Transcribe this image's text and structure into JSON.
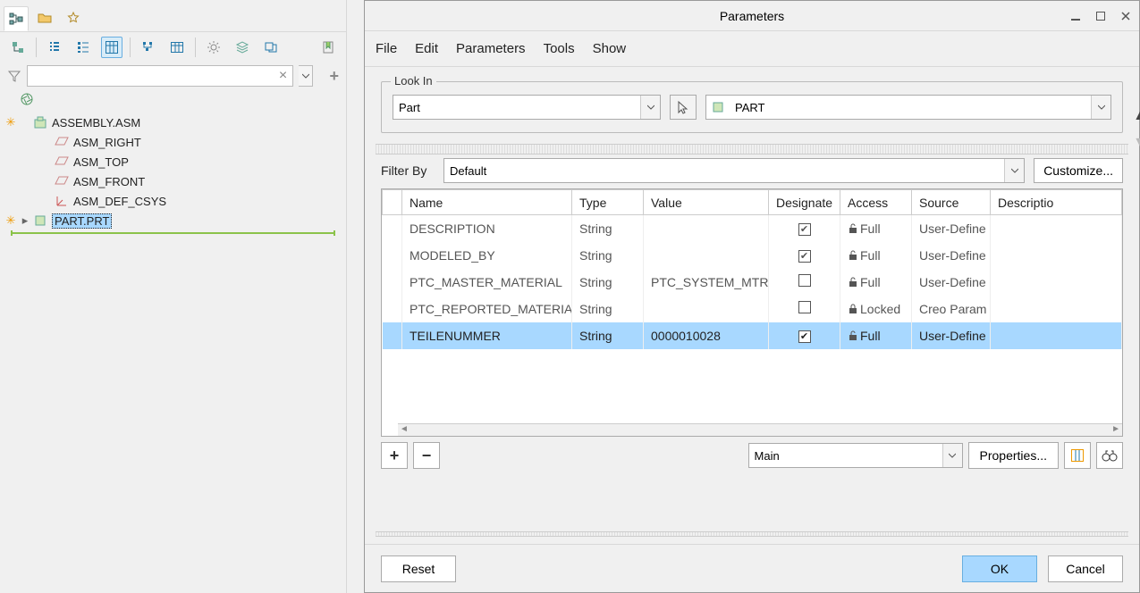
{
  "tree": {
    "root": "ASSEMBLY.ASM",
    "items": [
      "ASM_RIGHT",
      "ASM_TOP",
      "ASM_FRONT",
      "ASM_DEF_CSYS"
    ],
    "selected": "PART.PRT"
  },
  "dialog": {
    "title": "Parameters",
    "menu": {
      "file": "File",
      "edit": "Edit",
      "params": "Parameters",
      "tools": "Tools",
      "show": "Show"
    },
    "lookin": {
      "legend": "Look In",
      "type": "Part",
      "entity": "PART"
    },
    "filterby": {
      "label": "Filter By",
      "value": "Default",
      "customize": "Customize..."
    },
    "columns": {
      "name": "Name",
      "type": "Type",
      "value": "Value",
      "designate": "Designate",
      "access": "Access",
      "source": "Source",
      "description": "Descriptio"
    },
    "rows": [
      {
        "name": "DESCRIPTION",
        "type": "String",
        "value": "",
        "designate": true,
        "access": "Full",
        "source": "User-Define"
      },
      {
        "name": "MODELED_BY",
        "type": "String",
        "value": "",
        "designate": true,
        "access": "Full",
        "source": "User-Define"
      },
      {
        "name": "PTC_MASTER_MATERIAL",
        "type": "String",
        "value": "PTC_SYSTEM_MTRL",
        "designate": false,
        "access": "Full",
        "source": "User-Define"
      },
      {
        "name": "PTC_REPORTED_MATERIAL",
        "type": "String",
        "value": "",
        "designate": false,
        "access": "Locked",
        "source": "Creo Param"
      },
      {
        "name": "TEILENUMMER",
        "type": "String",
        "value": "0000010028",
        "designate": true,
        "access": "Full",
        "source": "User-Define",
        "selected": true
      }
    ],
    "table_dd": "Main",
    "properties_btn": "Properties...",
    "footer": {
      "reset": "Reset",
      "ok": "OK",
      "cancel": "Cancel"
    }
  }
}
